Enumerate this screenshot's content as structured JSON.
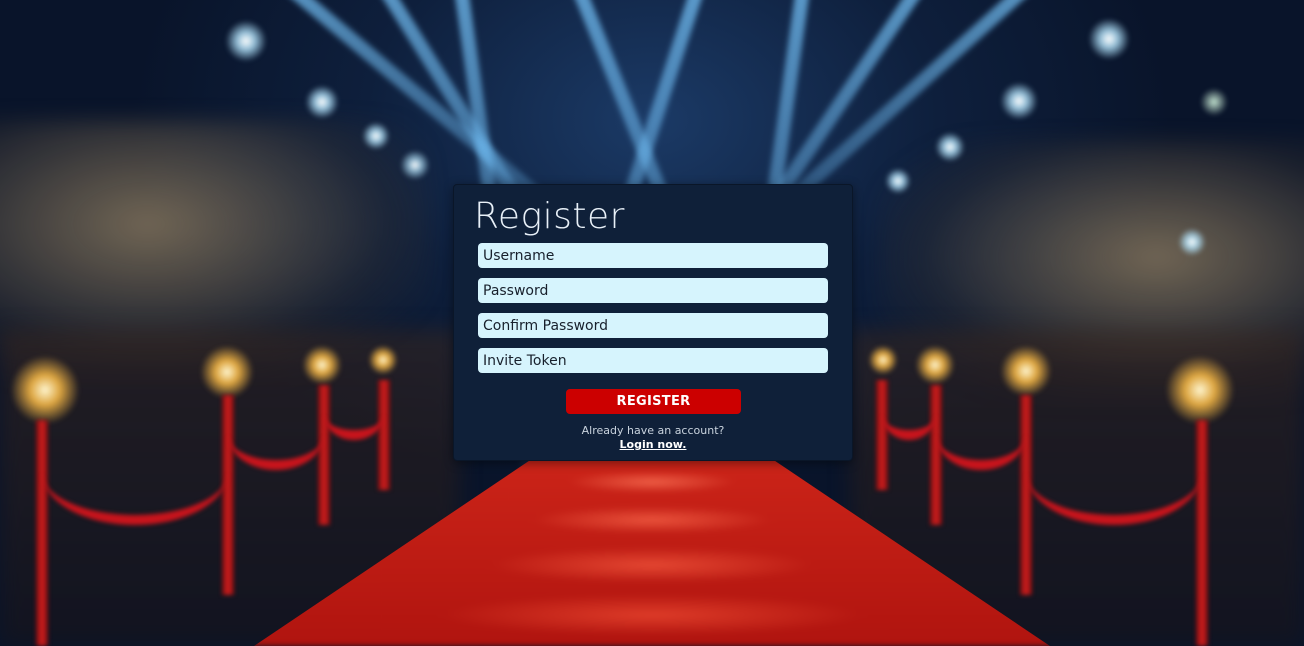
{
  "form": {
    "title": "Register",
    "fields": {
      "username_placeholder": "Username",
      "password_placeholder": "Password",
      "confirm_password_placeholder": "Confirm Password",
      "invite_token_placeholder": "Invite Token"
    },
    "submit_label": "REGISTER",
    "already_text": "Already have an account?",
    "login_link_text": "Login now."
  },
  "colors": {
    "card_background": "#0f2039",
    "input_background": "#d6f4fd",
    "button_background": "#cc0000",
    "title_text": "#e8f0f8"
  }
}
